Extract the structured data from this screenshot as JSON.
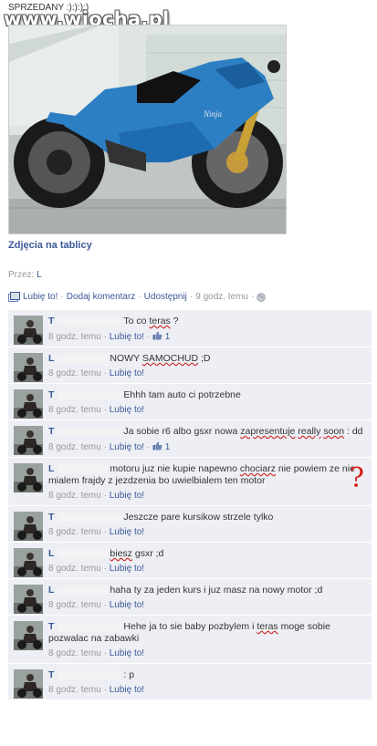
{
  "caption": "SPRZEDANY :):):):)",
  "watermark": "www.wiocha.pl",
  "photo": {
    "title": "Zdjęcia na tablicy",
    "by_label": "Przez:",
    "by_name": "L"
  },
  "actions": {
    "like": "Lubię to!",
    "comment": "Dodaj komentarz",
    "share": "Udostępnij",
    "time": "9 godz. temu"
  },
  "comments": [
    {
      "name": "T",
      "text": [
        "To co ",
        {
          "u": "teras"
        },
        " ?"
      ],
      "time": "8 godz. temu",
      "like": "Lubię to!",
      "likes": "1",
      "qmark": false
    },
    {
      "name": "L",
      "text": [
        "NOWY ",
        {
          "u": "SAMOCHUD"
        },
        " ;D"
      ],
      "time": "8 godz. temu",
      "like": "Lubię to!",
      "likes": "",
      "qmark": false
    },
    {
      "name": "T",
      "text": [
        "Ehhh tam auto ci potrzebne"
      ],
      "time": "8 godz. temu",
      "like": "Lubię to!",
      "likes": "",
      "qmark": false
    },
    {
      "name": "T",
      "text": [
        "Ja sobie r6 albo gsxr nowa ",
        {
          "u": "zapresentuje"
        },
        " ",
        {
          "u": "really"
        },
        " ",
        {
          "u": "soon"
        },
        " : dd"
      ],
      "time": "8 godz. temu",
      "like": "Lubię to!",
      "likes": "1",
      "qmark": false
    },
    {
      "name": "L",
      "text": [
        "motoru juz nie kupie napewno ",
        {
          "u": "chociarz"
        },
        " nie powiem ze nie mialem frajdy z jezdzenia bo uwielbialem ten motor"
      ],
      "time": "8 godz. temu",
      "like": "Lubię to!",
      "likes": "",
      "qmark": true
    },
    {
      "name": "T",
      "text": [
        "Jeszcze pare kursikow strzele tylko"
      ],
      "time": "8 godz. temu",
      "like": "Lubię to!",
      "likes": "",
      "qmark": false
    },
    {
      "name": "L",
      "text": [
        {
          "u": "biesz"
        },
        " gsxr ;d"
      ],
      "time": "8 godz. temu",
      "like": "Lubię to!",
      "likes": "",
      "qmark": false
    },
    {
      "name": "L",
      "text": [
        "haha ty za jeden kurs i juz masz na nowy motor ;d"
      ],
      "time": "8 godz. temu",
      "like": "Lubię to!",
      "likes": "",
      "qmark": false
    },
    {
      "name": "T",
      "text": [
        "Hehe ja to sie baby pozbylem i ",
        {
          "u": "teras"
        },
        " moge sobie pozwalac na zabawki"
      ],
      "time": "8 godz. temu",
      "like": "Lubię to!",
      "likes": "",
      "qmark": false
    },
    {
      "name": "T",
      "text": [
        ": p"
      ],
      "time": "8 godz. temu",
      "like": "Lubię to!",
      "likes": "",
      "qmark": false
    }
  ],
  "question_mark": "?",
  "colors": {
    "link": "#3b5998",
    "comment_bg": "#edeff4",
    "underline": "#d02020",
    "bike": "#2d7fc4"
  }
}
